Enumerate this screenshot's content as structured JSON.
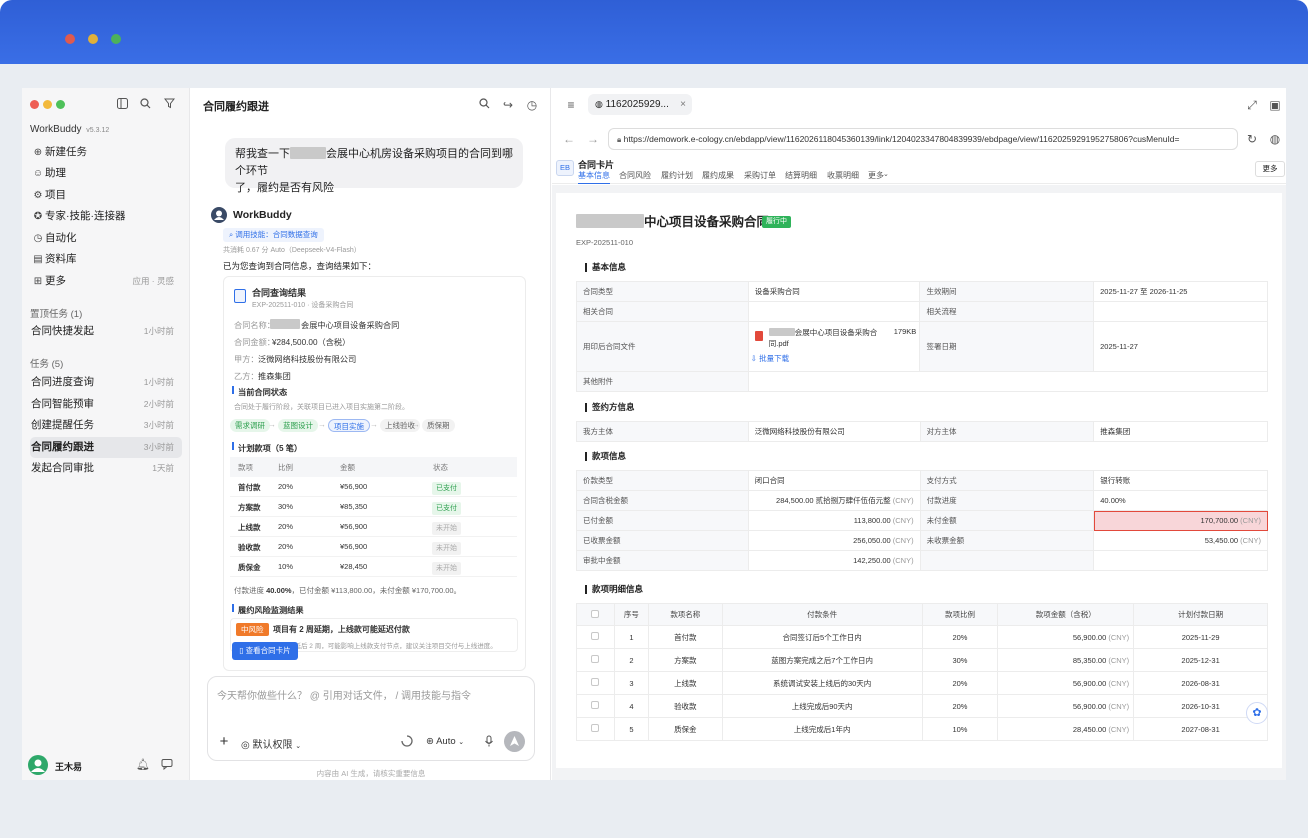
{
  "sidebar": {
    "app_name": "WorkBuddy",
    "version": "v5.3.12",
    "nav": [
      {
        "icon": "plus-circle-icon",
        "glyph": "⊕",
        "label": "新建任务"
      },
      {
        "icon": "assistant-icon",
        "glyph": "☺",
        "label": "助理"
      },
      {
        "icon": "project-icon",
        "glyph": "⚙",
        "label": "项目"
      },
      {
        "icon": "expert-icon",
        "glyph": "✪",
        "label": "专家·技能·连接器"
      },
      {
        "icon": "automation-icon",
        "glyph": "◷",
        "label": "自动化"
      },
      {
        "icon": "library-icon",
        "glyph": "▤",
        "label": "资料库"
      },
      {
        "icon": "more-grid-icon",
        "glyph": "⊞",
        "label": "更多",
        "tail": "应用 · 灵感"
      }
    ],
    "pinned_header": "置顶任务 (1)",
    "pinned": [
      {
        "label": "合同快捷发起",
        "time": "1小时前"
      }
    ],
    "tasks_header": "任务 (5)",
    "tasks": [
      {
        "label": "合同进度查询",
        "time": "1小时前"
      },
      {
        "label": "合同智能预审",
        "time": "2小时前"
      },
      {
        "label": "创建提醒任务",
        "time": "3小时前"
      },
      {
        "label": "合同履约跟进",
        "time": "3小时前"
      },
      {
        "label": "发起合同审批",
        "time": "1天前"
      }
    ],
    "user_name": "王木易"
  },
  "chat": {
    "title": "合同履约跟进",
    "user_msg_a": "帮我查一下",
    "user_msg_b": "会展中心机房设备采购项目的合同到哪个环节",
    "user_msg_c": "了，履约是否有风险",
    "bot_name": "WorkBuddy",
    "skill_chip": "调用技能：合同数据查询",
    "meta": "共消耗 0.67 分 Auto（Deepseek-V4-Flash）",
    "intro": "已为您查询到合同信息，查询结果如下：",
    "card": {
      "title": "合同查询结果",
      "subtitle": "EXP-202511-010 · 设备采购合同",
      "name_label": "合同名称：",
      "name_value": "会展中心项目设备采购合同",
      "amount_label": "合同金额：",
      "amount_value": "¥284,500.00（含税）",
      "partya_label": "甲方：",
      "partya_value": "泛微网络科技股份有限公司",
      "partyb_label": "乙方：",
      "partyb_value": "推森集团",
      "status_title": "当前合同状态",
      "status_desc": "合同处于履行阶段，关联项目已进入项目实施第二阶段。",
      "steps": [
        "需求调研",
        "蓝图设计",
        "项目实施",
        "上线验收",
        "质保期"
      ],
      "plan_title": "计划款项（5 笔）",
      "plan_headers": [
        "款项",
        "比例",
        "金额",
        "状态"
      ],
      "plan_rows": [
        {
          "name": "首付款",
          "ratio": "20%",
          "amount": "¥56,900",
          "status": "已支付",
          "paid": true
        },
        {
          "name": "方案款",
          "ratio": "30%",
          "amount": "¥85,350",
          "status": "已支付",
          "paid": true
        },
        {
          "name": "上线款",
          "ratio": "20%",
          "amount": "¥56,900",
          "status": "未开始",
          "paid": false
        },
        {
          "name": "验收款",
          "ratio": "20%",
          "amount": "¥56,900",
          "status": "未开始",
          "paid": false
        },
        {
          "name": "质保金",
          "ratio": "10%",
          "amount": "¥28,450",
          "status": "未开始",
          "paid": false
        }
      ],
      "progress_a": "付款进度 ",
      "progress_b": "40.00%",
      "progress_c": "，已付金额 ¥113,800.00，未付金额 ¥170,700.00。",
      "risk_title": "履约风险监测结果",
      "risk_badge": "中风险",
      "risk_head": "项目有 2 周延期，上线款可能延迟付款",
      "risk_desc": "项目实施进度较计划延后 2 周，可能影响上线款支付节点，建议关注项目交付与上线进度。",
      "view_button": "查看合同卡片"
    },
    "input_placeholder": "今天帮你做些什么？ @ 引用对话文件， / 调用技能与指令",
    "permission": "默认权限",
    "model": "Auto",
    "footnote": "内容由 AI 生成，请核实重要信息"
  },
  "browser": {
    "tab_title": "1162025929...",
    "url": "https://demowork.e-cology.cn/ebdapp/view/1162026118045360139/link/1204023347804839939/ebdpage/view/1162025929195275806?cusMenuId=",
    "card_badge": "EB",
    "card_title": "合同卡片",
    "tabs": [
      "基本信息",
      "合同风险",
      "履约计划",
      "履约成果",
      "采购订单",
      "结算明细",
      "收票明细",
      "更多"
    ],
    "more_button": "更多",
    "doc_title": "中心项目设备采购合同",
    "doc_status": "履行中",
    "doc_code": "EXP-202511-010",
    "sec_basic": "基本信息",
    "basic": {
      "type_label": "合同类型",
      "type_value": "设备采购合同",
      "period_label": "生效期间",
      "period_value": "2025-11-27 至 2026-11-25",
      "related_label": "相关合同",
      "flow_label": "相关流程",
      "file_label": "用印后合同文件",
      "file_name_a": "会展中心项目设备采购合",
      "file_name_b": "同.pdf",
      "file_size": "179KB",
      "batch_download": "批量下载",
      "sign_label": "签署日期",
      "sign_value": "2025-11-27",
      "attach_label": "其他附件"
    },
    "sec_party": "签约方信息",
    "party": {
      "our_label": "我方主体",
      "our_value": "泛微网络科技股份有限公司",
      "other_label": "对方主体",
      "other_value": "推森集团"
    },
    "sec_pay": "款项信息",
    "pay": {
      "price_type_label": "价款类型",
      "price_type_value": "闭口合同",
      "pay_method_label": "支付方式",
      "pay_method_value": "银行转账",
      "tax_amount_label": "合同含税金额",
      "tax_amount_value": "284,500.00  贰拾捌万肆仟伍佰元整",
      "pay_progress_label": "付款进度",
      "pay_progress_value": "40.00%",
      "paid_label": "已付金额",
      "paid_value": "113,800.00",
      "unpaid_label": "未付金额",
      "unpaid_value": "170,700.00",
      "invoiced_label": "已收票金额",
      "invoiced_value": "256,050.00",
      "uninvoiced_label": "未收票金额",
      "uninvoiced_value": "53,450.00",
      "approving_label": "审批中金额",
      "approving_value": "142,250.00",
      "currency": "(CNY)"
    },
    "sec_detail": "款项明细信息",
    "detail_headers": [
      "序号",
      "款项名称",
      "付款条件",
      "款项比例",
      "款项金额（含税）",
      "计划付款日期"
    ],
    "detail_rows": [
      {
        "no": "1",
        "name": "首付款",
        "cond": "合同签订后5个工作日内",
        "ratio": "20%",
        "amount": "56,900.00",
        "date": "2025-11-29"
      },
      {
        "no": "2",
        "name": "方案款",
        "cond": "蓝图方案完成之后7个工作日内",
        "ratio": "30%",
        "amount": "85,350.00",
        "date": "2025-12-31"
      },
      {
        "no": "3",
        "name": "上线款",
        "cond": "系统调试安装上线后的30天内",
        "ratio": "20%",
        "amount": "56,900.00",
        "date": "2026-08-31"
      },
      {
        "no": "4",
        "name": "验收款",
        "cond": "上线完成后90天内",
        "ratio": "20%",
        "amount": "56,900.00",
        "date": "2026-10-31"
      },
      {
        "no": "5",
        "name": "质保金",
        "cond": "上线完成后1年内",
        "ratio": "10%",
        "amount": "28,450.00",
        "date": "2027-08-31"
      }
    ]
  },
  "colors": {
    "accent": "#2f6fe8",
    "frame_blue": "#3163d9",
    "risk_orange": "#f07a2a",
    "highlight_red": "#f8d6d9",
    "status_green": "#2fb35a"
  }
}
